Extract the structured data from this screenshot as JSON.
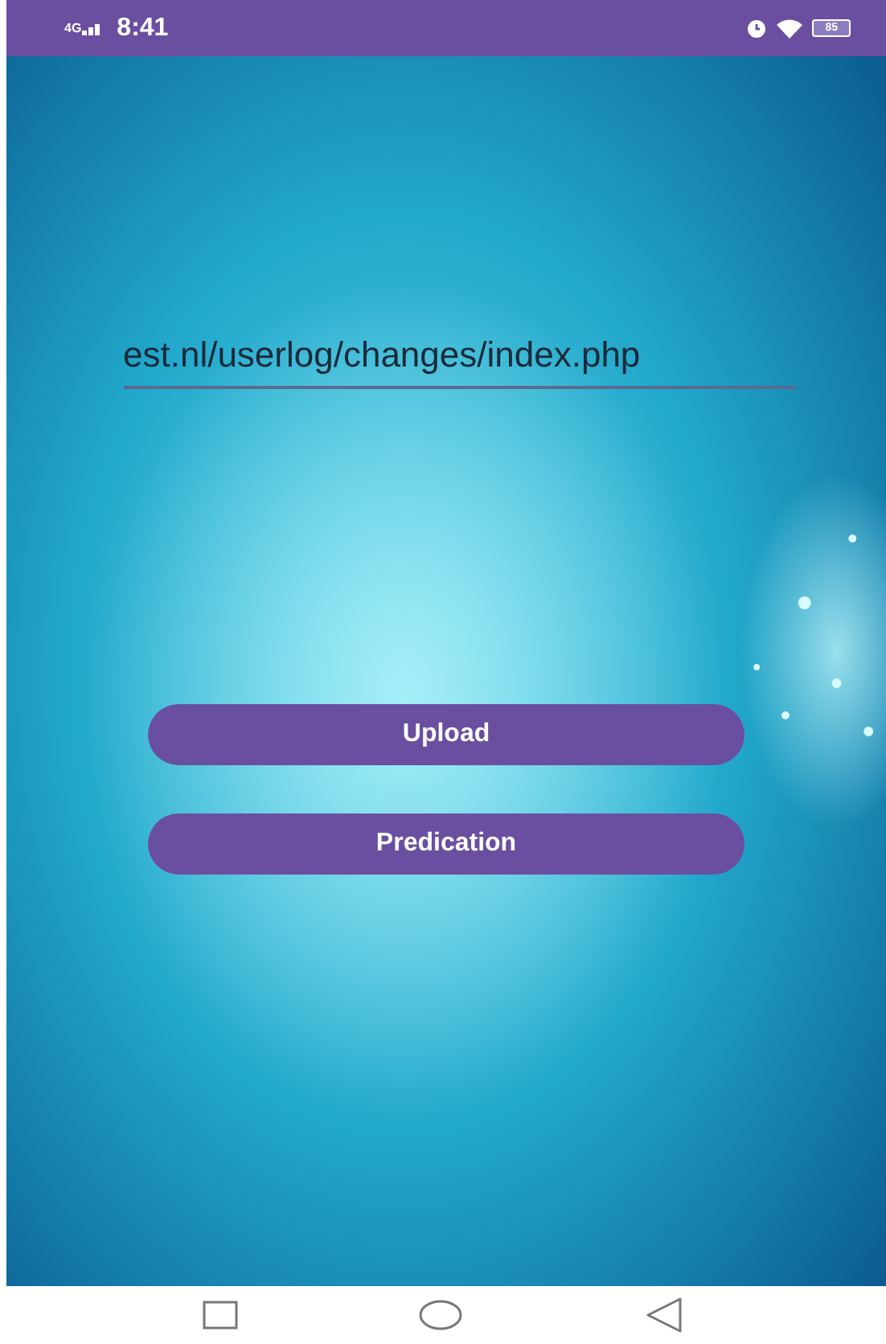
{
  "status_bar": {
    "network": "4G",
    "time": "8:41",
    "battery": "85"
  },
  "url_field": {
    "value": "est.nl/userlog/changes/index.php"
  },
  "buttons": [
    {
      "label": "Upload"
    },
    {
      "label": "Predication"
    }
  ]
}
